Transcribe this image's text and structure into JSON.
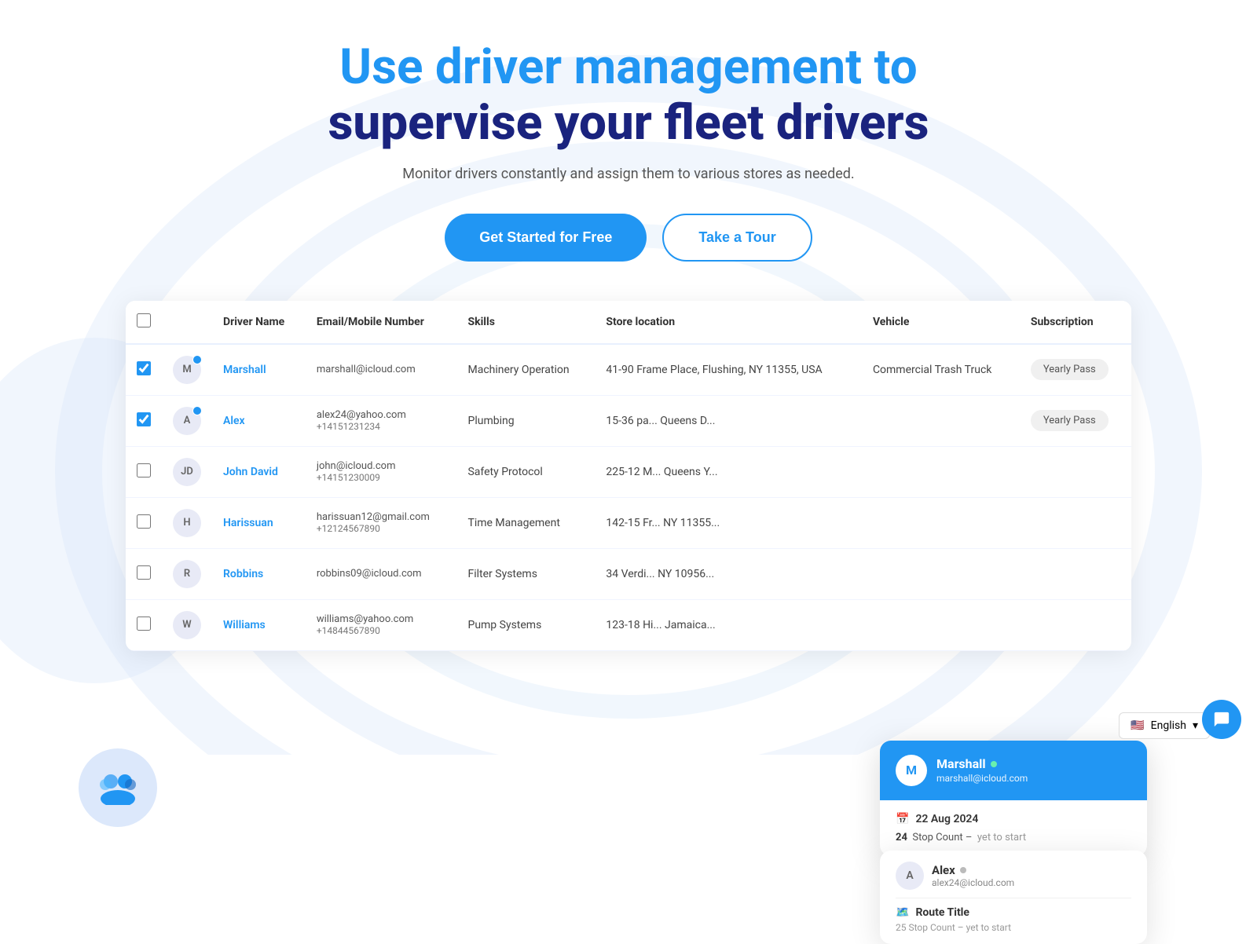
{
  "hero": {
    "title_line1": "Use driver management to",
    "title_line2": "supervise your fleet drivers",
    "subtitle": "Monitor drivers constantly and assign them to various stores as needed.",
    "btn_primary": "Get Started for Free",
    "btn_secondary": "Take a Tour"
  },
  "table": {
    "headers": [
      "",
      "",
      "Driver Name",
      "Email/Mobile Number",
      "Skills",
      "Store location",
      "Vehicle",
      "Subscription"
    ],
    "rows": [
      {
        "checked": true,
        "avatar_initials": "M",
        "has_blue_dot": true,
        "name": "Marshall",
        "email": "marshall@icloud.com",
        "mobile": "",
        "skills": "Machinery Operation",
        "store": "41-90 Frame Place, Flushing, NY 11355, USA",
        "vehicle": "Commercial Trash Truck",
        "subscription": "Yearly Pass"
      },
      {
        "checked": true,
        "avatar_initials": "A",
        "has_blue_dot": true,
        "name": "Alex",
        "email": "alex24@yahoo.com",
        "mobile": "+14151231234",
        "skills": "Plumbing",
        "store": "15-36 pa... Queens D...",
        "vehicle": "",
        "subscription": "Yearly Pass"
      },
      {
        "checked": false,
        "avatar_initials": "JD",
        "has_blue_dot": false,
        "name": "John David",
        "email": "john@icloud.com",
        "mobile": "+14151230009",
        "skills": "Safety Protocol",
        "store": "225-12 M... Queens Y...",
        "vehicle": "",
        "subscription": ""
      },
      {
        "checked": false,
        "avatar_initials": "H",
        "has_blue_dot": false,
        "name": "Harissuan",
        "email": "harissuan12@gmail.com",
        "mobile": "+12124567890",
        "skills": "Time Management",
        "store": "142-15 Fr... NY 11355...",
        "vehicle": "",
        "subscription": ""
      },
      {
        "checked": false,
        "avatar_initials": "R",
        "has_blue_dot": false,
        "name": "Robbins",
        "email": "robbins09@icloud.com",
        "mobile": "",
        "skills": "Filter Systems",
        "store": "34 Verdi... NY 10956...",
        "vehicle": "",
        "subscription": ""
      },
      {
        "checked": false,
        "avatar_initials": "W",
        "has_blue_dot": false,
        "name": "Williams",
        "email": "williams@yahoo.com",
        "mobile": "+14844567890",
        "skills": "Pump Systems",
        "store": "123-18 Hi... Jamaica...",
        "vehicle": "",
        "subscription": ""
      }
    ]
  },
  "popup_marshall": {
    "avatar": "M",
    "name": "Marshall",
    "email": "marshall@icloud.com",
    "date": "22 Aug 2024",
    "stop_count": "24",
    "stop_label": "Stop Count",
    "status": "yet to start"
  },
  "popup_alex": {
    "avatar": "A",
    "name": "Alex",
    "email": "alex24@icloud.com",
    "route_title": "Route Title",
    "route_sub": "25 Stop Count – yet to start"
  },
  "language": {
    "label": "English"
  }
}
